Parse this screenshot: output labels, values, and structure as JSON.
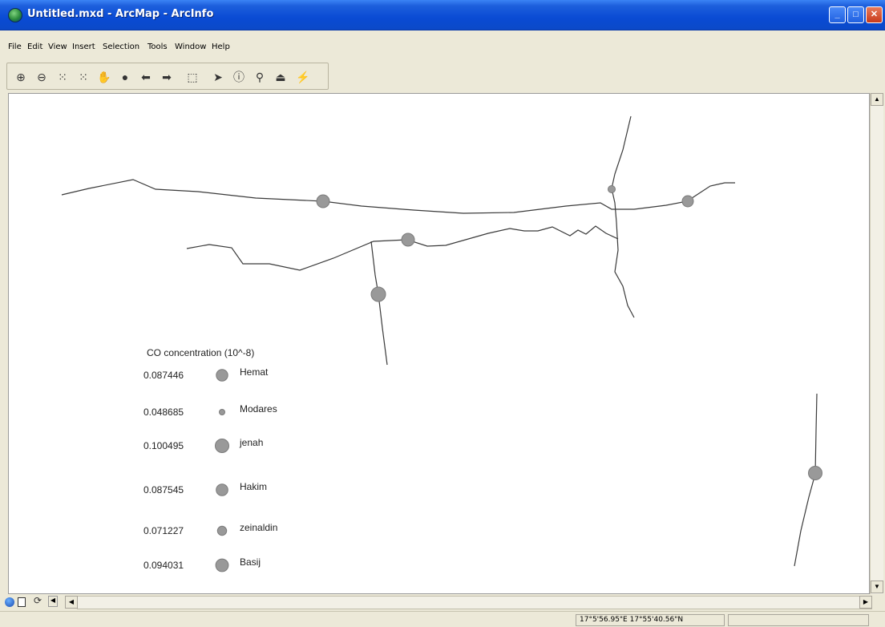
{
  "window": {
    "title": "Untitled.mxd - ArcMap - ArcInfo"
  },
  "menu": [
    {
      "label": "File"
    },
    {
      "label": "Edit"
    },
    {
      "label": "View"
    },
    {
      "label": "Insert"
    },
    {
      "label": "Selection"
    },
    {
      "label": "Tools"
    },
    {
      "label": "Window"
    },
    {
      "label": "Help"
    }
  ],
  "toolbar": [
    {
      "icon": "zoom-in-icon",
      "glyph": "⊕"
    },
    {
      "icon": "zoom-out-icon",
      "glyph": "⊖"
    },
    {
      "icon": "fixed-zoom-in-icon",
      "glyph": "⁙"
    },
    {
      "icon": "fixed-zoom-out-icon",
      "glyph": "⁙"
    },
    {
      "icon": "pan-icon",
      "glyph": "✋"
    },
    {
      "icon": "full-extent-icon",
      "glyph": "●"
    },
    {
      "icon": "back-extent-icon",
      "glyph": "⬅"
    },
    {
      "icon": "forward-extent-icon",
      "glyph": "➡"
    },
    {
      "icon": "select-features-icon",
      "glyph": "⬚"
    },
    {
      "icon": "select-elements-icon",
      "glyph": "➤"
    },
    {
      "icon": "identify-icon",
      "glyph": "ⓘ"
    },
    {
      "icon": "find-icon",
      "glyph": "⚲"
    },
    {
      "icon": "measure-icon",
      "glyph": "⏏"
    },
    {
      "icon": "hyperlink-icon",
      "glyph": "⚡"
    }
  ],
  "legend": {
    "title": "CO concentration (10^-8)",
    "items": [
      {
        "value": "0.087446",
        "name": "Hemat",
        "size": 0.087446
      },
      {
        "value": "0.048685",
        "name": "Modares",
        "size": 0.048685
      },
      {
        "value": "0.100495",
        "name": "jenah",
        "size": 0.100495
      },
      {
        "value": "0.087545",
        "name": "Hakim",
        "size": 0.087545
      },
      {
        "value": "0.071227",
        "name": "zeinaldin",
        "size": 0.071227
      },
      {
        "value": "0.094031",
        "name": "Basij",
        "size": 0.094031
      }
    ]
  },
  "colors": {
    "road": "#3a3a3a",
    "station": "#999999",
    "station_outline": "#7a7a7a"
  },
  "status": {
    "coordinates": "17°5'56.95\"E  17°55'40.56\"N"
  }
}
